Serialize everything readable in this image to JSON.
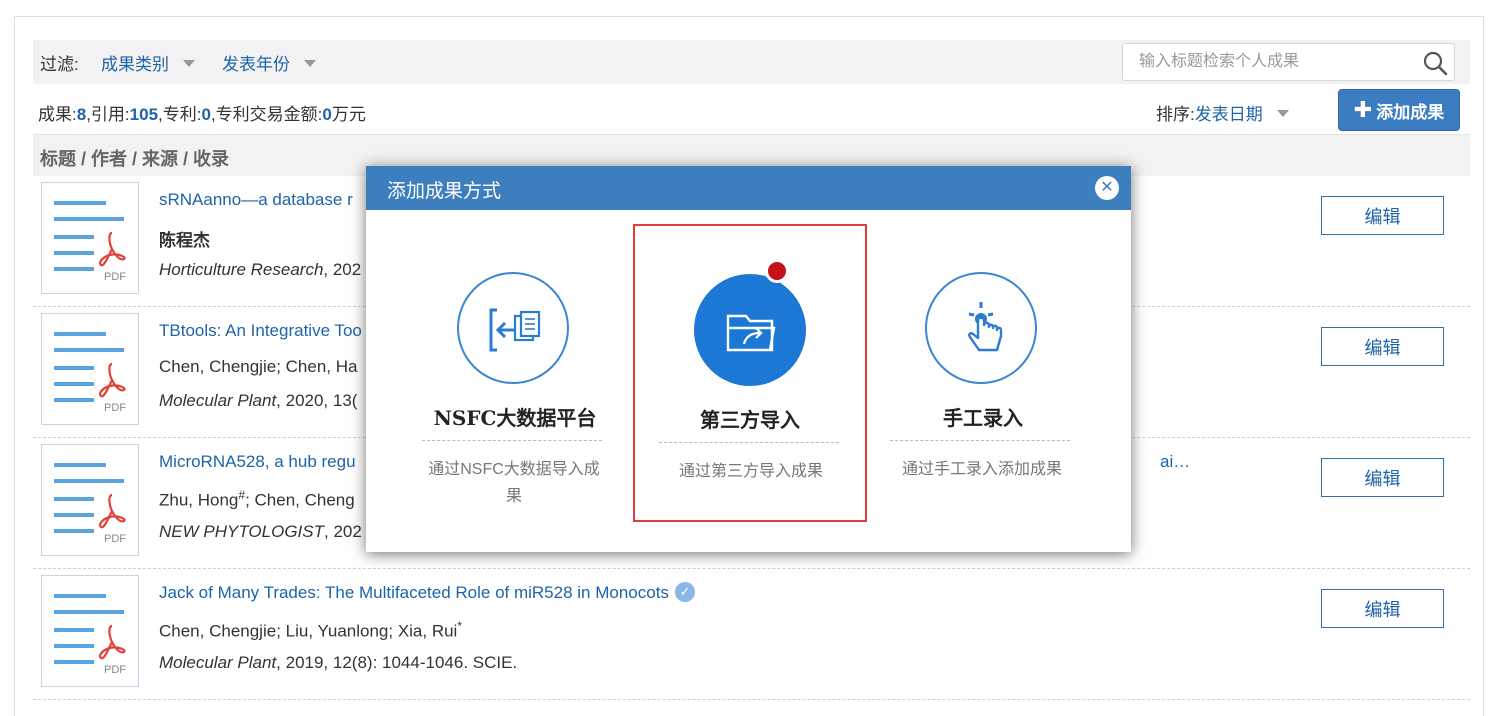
{
  "filter": {
    "label": "过滤:",
    "category": "成果类别",
    "year": "发表年份",
    "search_placeholder": "输入标题检索个人成果"
  },
  "stats": {
    "results_label": "成果:",
    "results": "8",
    "citations_label": ",引用:",
    "citations": "105",
    "patents_label": ",专利:",
    "patents": "0",
    "amount_label": ",专利交易金额:",
    "amount": "0",
    "amount_unit": "万元"
  },
  "sort": {
    "label": "排序:",
    "value": "发表日期"
  },
  "add_button": {
    "label": "添加成果"
  },
  "list_header": "标题 / 作者 / 来源 / 收录",
  "rows": [
    {
      "title": "sRNAanno—a database r",
      "authors": "陈程杰",
      "journal": "Horticulture Research",
      "rest": ", 202",
      "edit": "编辑"
    },
    {
      "title": "TBtools: An Integrative Too",
      "authors": "Chen, Chengjie; Chen, Ha",
      "journal": "Molecular Plant",
      "rest": ", 2020, 13(",
      "edit": "编辑"
    },
    {
      "title": "MicroRNA528, a hub regu",
      "title_tail": "ai…",
      "authors_a": "Zhu, Hong",
      "authors_a_sup": "#",
      "authors_b": "; Chen, Cheng",
      "journal": "NEW PHYTOLOGIST",
      "rest": ", 202",
      "edit": "编辑"
    },
    {
      "title": "Jack of Many Trades: The Multifaceted Role of miR528 in Monocots",
      "authors": "Chen, Chengjie; Liu, Yuanlong; Xia, Rui",
      "authors_sup": "*",
      "journal": "Molecular Plant",
      "rest": ", 2019, 12(8): 1044-1046.  SCIE.",
      "edit": "编辑"
    }
  ],
  "modal": {
    "title": "添加成果方式",
    "options": [
      {
        "title": "NSFC大数据平台",
        "desc": "通过NSFC大数据导入成果",
        "icon": "import-icon"
      },
      {
        "title": "第三方导入",
        "desc": "通过第三方导入成果",
        "icon": "folder-share-icon"
      },
      {
        "title": "手工录入",
        "desc": "通过手工录入添加成果",
        "icon": "hand-tap-icon"
      }
    ]
  },
  "colors": {
    "accent": "#3d7ebf",
    "link": "#1e64a8",
    "selected_border": "#e23b3b"
  }
}
